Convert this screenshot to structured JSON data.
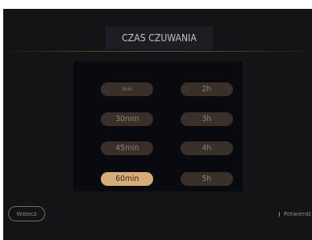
{
  "header": {
    "title": "CZAS CZUWANIA"
  },
  "options": {
    "left": [
      {
        "label": "brak",
        "selected": false
      },
      {
        "label": "30min",
        "selected": false
      },
      {
        "label": "45min",
        "selected": false
      },
      {
        "label": "60min",
        "selected": true
      }
    ],
    "right": [
      {
        "label": "2h",
        "selected": false
      },
      {
        "label": "3h",
        "selected": false
      },
      {
        "label": "4h",
        "selected": false
      },
      {
        "label": "5h",
        "selected": false
      }
    ]
  },
  "footer": {
    "back_label": "Wstecz",
    "confirm_label": "Potwierdź"
  },
  "colors": {
    "background": "#141416",
    "panel": "#080a10",
    "option": "#3a302a",
    "option_selected": "#d8ac78",
    "text": "#c9c2b8"
  }
}
